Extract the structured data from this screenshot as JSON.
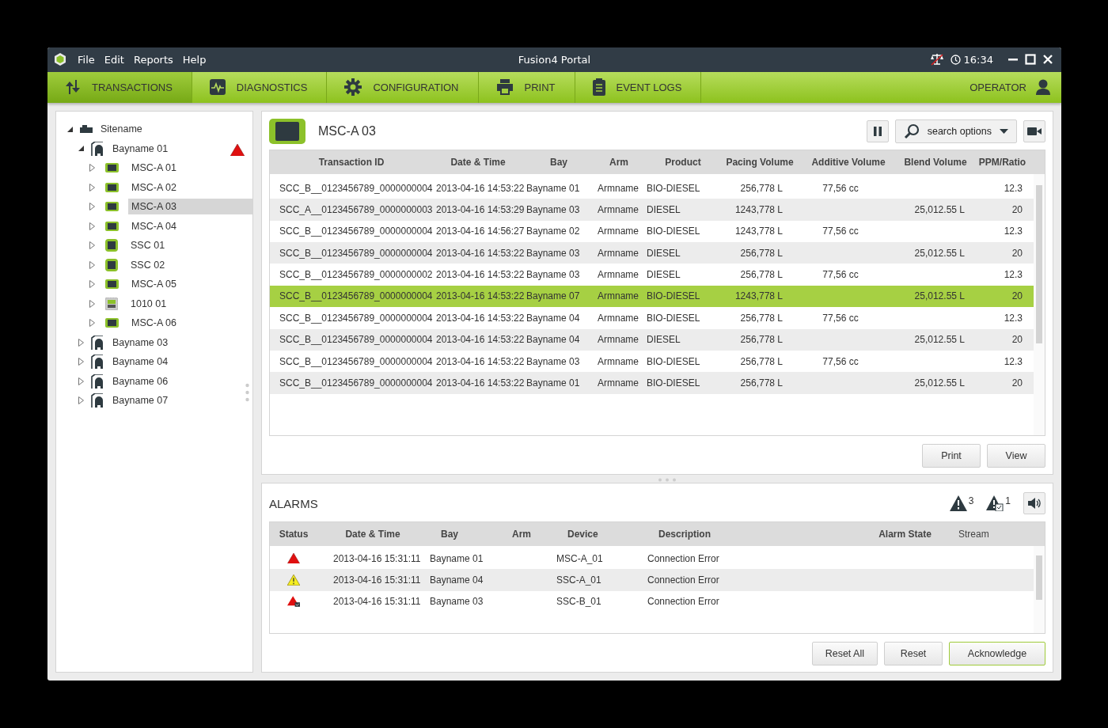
{
  "window": {
    "title": "Fusion4 Portal",
    "time": "16:34"
  },
  "menu": [
    "File",
    "Edit",
    "Reports",
    "Help"
  ],
  "tabs": [
    {
      "label": "TRANSACTIONS",
      "kind": "transactions",
      "selected": true
    },
    {
      "label": "DIAGNOSTICS",
      "kind": "diagnostics",
      "selected": false
    },
    {
      "label": "CONFIGURATION",
      "kind": "configuration",
      "selected": false
    },
    {
      "label": "PRINT",
      "kind": "print",
      "selected": false
    },
    {
      "label": "EVENT LOGS",
      "kind": "logs",
      "selected": false
    }
  ],
  "user": "OPERATOR",
  "tree": [
    {
      "label": "Sitename",
      "kind": "site",
      "expanded": true,
      "selected": false,
      "alert": false,
      "children": [
        {
          "label": "Bayname 01",
          "kind": "bay",
          "expanded": true,
          "selected": false,
          "alert": true,
          "children": [
            {
              "label": "MSC-A 01",
              "kind": "msc",
              "expanded": false,
              "selected": false,
              "alert": false
            },
            {
              "label": "MSC-A 02",
              "kind": "msc",
              "expanded": false,
              "selected": false,
              "alert": false
            },
            {
              "label": "MSC-A 03",
              "kind": "msc",
              "expanded": false,
              "selected": true,
              "alert": false
            },
            {
              "label": "MSC-A 04",
              "kind": "msc",
              "expanded": false,
              "selected": false,
              "alert": false
            },
            {
              "label": "SSC 01",
              "kind": "ssc",
              "expanded": false,
              "selected": false,
              "alert": false
            },
            {
              "label": "SSC 02",
              "kind": "ssc",
              "expanded": false,
              "selected": false,
              "alert": false
            },
            {
              "label": "MSC-A 05",
              "kind": "msc",
              "expanded": false,
              "selected": false,
              "alert": false
            },
            {
              "label": "1010 01",
              "kind": "io",
              "expanded": false,
              "selected": false,
              "alert": false
            },
            {
              "label": "MSC-A 06",
              "kind": "msc",
              "expanded": false,
              "selected": false,
              "alert": false
            }
          ]
        },
        {
          "label": "Bayname 03",
          "kind": "bay",
          "expanded": false,
          "selected": false,
          "alert": false
        },
        {
          "label": "Bayname 04",
          "kind": "bay",
          "expanded": false,
          "selected": false,
          "alert": false
        },
        {
          "label": "Bayname 06",
          "kind": "bay",
          "expanded": false,
          "selected": false,
          "alert": false
        },
        {
          "label": "Bayname 07",
          "kind": "bay",
          "expanded": false,
          "selected": false,
          "alert": false
        }
      ]
    }
  ],
  "device_title": "MSC-A 03",
  "search_button": "search options",
  "transactions": {
    "columns": [
      "Transaction ID",
      "Date & Time",
      "Bay",
      "Arm",
      "Product",
      "Pacing Volume",
      "Additive Volume",
      "Blend Volume",
      "PPM/Ratio"
    ],
    "rows": [
      {
        "cells": [
          "SCC_B__0123456789_0000000004",
          "2013-04-16 14:53:22",
          "Bayname 01",
          "Armname",
          "BIO-DIESEL",
          "256,778 L",
          "77,56 cc",
          "",
          "12.3"
        ],
        "selected": false
      },
      {
        "cells": [
          "SCC_A__0123456789_0000000003",
          "2013-04-16 14:53:29",
          "Bayname 03",
          "Armname",
          "DIESEL",
          "1243,778 L",
          "",
          "25,012.55 L",
          "20"
        ],
        "selected": false
      },
      {
        "cells": [
          "SCC_B__0123456789_0000000004",
          "2013-04-16 14:56:27",
          "Bayname 02",
          "Armname",
          "BIO-DIESEL",
          "1243,778 L",
          "77,56 cc",
          "",
          "12.3"
        ],
        "selected": false
      },
      {
        "cells": [
          "SCC_B__0123456789_0000000004",
          "2013-04-16 14:53:22",
          "Bayname 03",
          "Armname",
          "DIESEL",
          "256,778 L",
          "",
          "25,012.55 L",
          "20"
        ],
        "selected": false
      },
      {
        "cells": [
          "SCC_B__0123456789_0000000002",
          "2013-04-16 14:53:22",
          "Bayname 03",
          "Armname",
          "DIESEL",
          "256,778 L",
          "77,56 cc",
          "",
          "12.3"
        ],
        "selected": false
      },
      {
        "cells": [
          "SCC_B__0123456789_0000000004",
          "2013-04-16 14:53:22",
          "Bayname 07",
          "Armname",
          "BIO-DIESEL",
          "1243,778 L",
          "",
          "25,012.55 L",
          "20"
        ],
        "selected": true
      },
      {
        "cells": [
          "SCC_B__0123456789_0000000004",
          "2013-04-16 14:53:22",
          "Bayname 04",
          "Armname",
          "BIO-DIESEL",
          "256,778 L",
          "77,56 cc",
          "",
          "12.3"
        ],
        "selected": false
      },
      {
        "cells": [
          "SCC_B__0123456789_0000000004",
          "2013-04-16 14:53:22",
          "Bayname 04",
          "Armname",
          "DIESEL",
          "256,778 L",
          "",
          "25,012.55 L",
          "20"
        ],
        "selected": false
      },
      {
        "cells": [
          "SCC_B__0123456789_0000000004",
          "2013-04-16 14:53:22",
          "Bayname 03",
          "Armname",
          "BIO-DIESEL",
          "256,778 L",
          "77,56 cc",
          "",
          "12.3"
        ],
        "selected": false
      },
      {
        "cells": [
          "SCC_B__0123456789_0000000004",
          "2013-04-16 14:53:22",
          "Bayname 01",
          "Armname",
          "BIO-DIESEL",
          "256,778 L",
          "",
          "25,012.55 L",
          "20"
        ],
        "selected": false
      }
    ]
  },
  "transaction_buttons": [
    "Print",
    "View"
  ],
  "alarms": {
    "title": "ALARMS",
    "active_count": "3",
    "acknowledged_count": "1",
    "columns": [
      "Status",
      "Date & Time",
      "Bay",
      "Arm",
      "Device",
      "Description",
      "Alarm State",
      "Stream"
    ],
    "rows": [
      {
        "kind": "alarm",
        "cells": [
          "",
          "2013-04-16 15:31:11",
          "Bayname 01",
          "",
          "MSC-A_01",
          "Connection Error",
          "",
          ""
        ]
      },
      {
        "kind": "warning",
        "cells": [
          "",
          "2013-04-16 15:31:11",
          "Bayname 04",
          "",
          "SSC-A_01",
          "Connection Error",
          "",
          ""
        ]
      },
      {
        "kind": "acknowledged",
        "cells": [
          "",
          "2013-04-16 15:31:11",
          "Bayname 03",
          "",
          "SSC-B_01",
          "Connection Error",
          "",
          ""
        ]
      }
    ]
  },
  "alarm_buttons": [
    {
      "label": "Reset All",
      "primary": false
    },
    {
      "label": "Reset",
      "primary": false
    },
    {
      "label": "Acknowledge",
      "primary": true
    }
  ]
}
